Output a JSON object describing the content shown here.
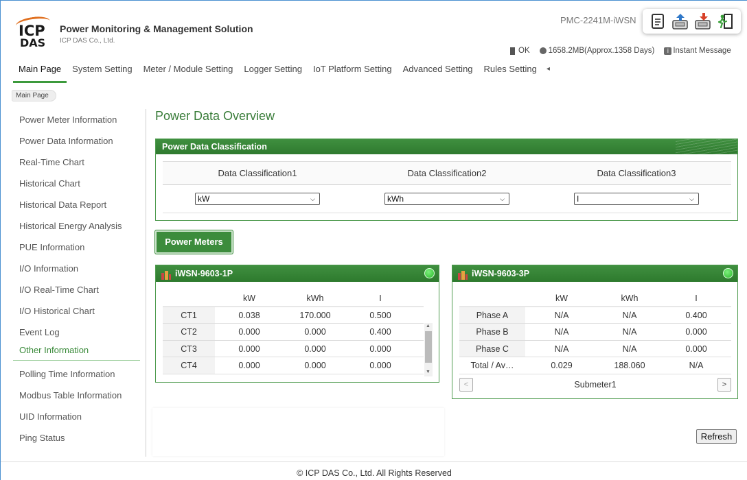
{
  "header": {
    "logo_top": "ICP",
    "logo_bottom": "DAS",
    "app_title": "Power Monitoring & Management Solution",
    "company": "ICP DAS Co., Ltd.",
    "device_name": "PMC-2241M-iWSN",
    "toolbar_icons": [
      "document-icon",
      "upload-icon",
      "download-icon",
      "logout-icon"
    ]
  },
  "status": {
    "ok": "OK",
    "storage": "1658.2MB(Approx.1358 Days)",
    "instant_message": "Instant Message"
  },
  "nav": {
    "tabs": [
      "Main Page",
      "System Setting",
      "Meter / Module Setting",
      "Logger Setting",
      "IoT Platform Setting",
      "Advanced Setting",
      "Rules Setting"
    ],
    "more": "◂"
  },
  "breadcrumb": "Main Page",
  "sidebar": {
    "items": [
      "Power Meter Information",
      "Power Data Information",
      "Real-Time Chart",
      "Historical Chart",
      "Historical Data Report",
      "Historical Energy Analysis",
      "PUE Information",
      "I/O Information",
      "I/O Real-Time Chart",
      "I/O Historical Chart",
      "Event Log",
      "Other Information",
      "Polling Time Information",
      "Modbus Table Information",
      "UID Information",
      "Ping Status"
    ],
    "active": "Other Information"
  },
  "main": {
    "title": "Power Data Overview",
    "classification": {
      "heading": "Power Data Classification",
      "headers": [
        "Data Classification1",
        "Data Classification2",
        "Data Classification3"
      ],
      "values": [
        "kW",
        "kWh",
        "I"
      ]
    },
    "power_meters_button": "Power Meters",
    "meter1": {
      "name": "iWSN-9603-1P",
      "columns": [
        "",
        "kW",
        "kWh",
        "I"
      ],
      "rows": [
        [
          "CT1",
          "0.038",
          "170.000",
          "0.500"
        ],
        [
          "CT2",
          "0.000",
          "0.000",
          "0.400"
        ],
        [
          "CT3",
          "0.000",
          "0.000",
          "0.000"
        ],
        [
          "CT4",
          "0.000",
          "0.000",
          "0.000"
        ]
      ]
    },
    "meter2": {
      "name": "iWSN-9603-3P",
      "columns": [
        "",
        "kW",
        "kWh",
        "I"
      ],
      "rows": [
        [
          "Phase A",
          "N/A",
          "N/A",
          "0.400"
        ],
        [
          "Phase B",
          "N/A",
          "N/A",
          "0.000"
        ],
        [
          "Phase C",
          "N/A",
          "N/A",
          "0.000"
        ],
        [
          "Total / Av…",
          "0.029",
          "188.060",
          "N/A"
        ]
      ],
      "submeter": "Submeter1",
      "prev": "<",
      "next": ">"
    },
    "refresh_label": "Refresh"
  },
  "footer": "© ICP DAS Co., Ltd. All Rights Reserved",
  "colors": {
    "accent_green": "#3c8c3c",
    "link_blue_border": "#4a8fd0",
    "logo_orange": "#e07020"
  }
}
